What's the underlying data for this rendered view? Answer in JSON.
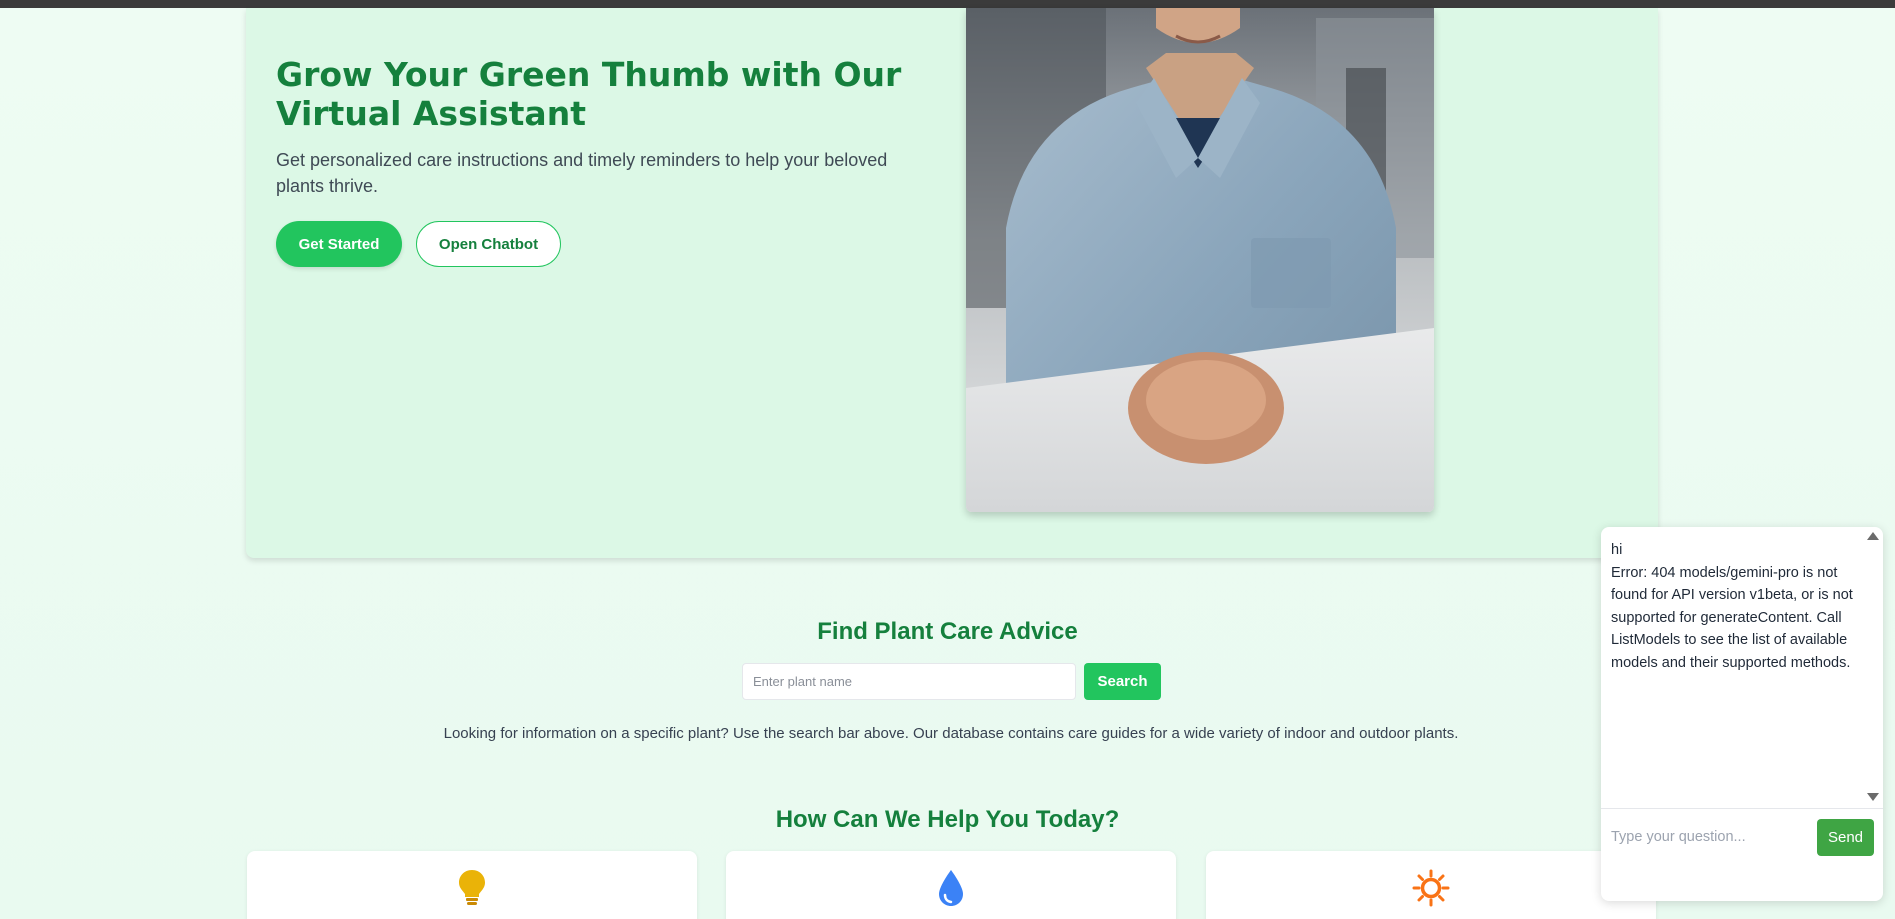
{
  "hero": {
    "title": "Grow Your Green Thumb with Our Virtual Assistant",
    "subtitle": "Get personalized care instructions and timely reminders to help your beloved plants thrive.",
    "primary_button": "Get Started",
    "secondary_button": "Open Chatbot"
  },
  "search": {
    "title": "Find Plant Care Advice",
    "placeholder": "Enter plant name",
    "button": "Search",
    "description": "Looking for information on a specific plant? Use the search bar above. Our database contains care guides for a wide variety of indoor and outdoor plants."
  },
  "help": {
    "title": "How Can We Help You Today?",
    "cards": [
      {
        "icon": "lightbulb-icon",
        "color": "#eab308"
      },
      {
        "icon": "water-drop-icon",
        "color": "#3b82f6"
      },
      {
        "icon": "sun-icon",
        "color": "#f97316"
      }
    ]
  },
  "chat": {
    "messages": [
      "hi",
      "Error: 404 models/gemini-pro is not found for API version v1beta, or is not supported for generateContent. Call ListModels to see the list of available models and their supported methods."
    ],
    "input_placeholder": "Type your question...",
    "send_label": "Send"
  },
  "colors": {
    "brand_green": "#15803d",
    "accent_green": "#22c55e",
    "hero_bg": "#dcf8e6"
  }
}
